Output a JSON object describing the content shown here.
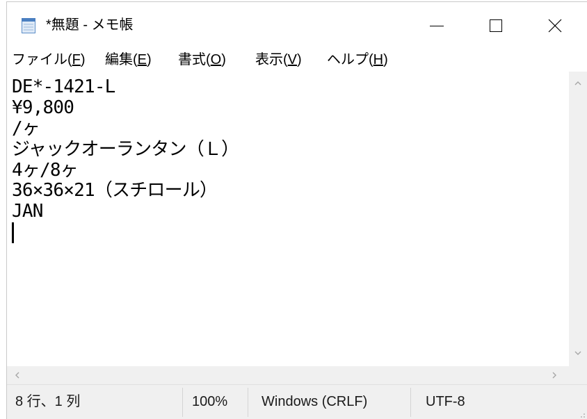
{
  "window": {
    "title": "*無題 - メモ帳",
    "app_icon": "notepad-icon",
    "controls": {
      "minimize_icon": "minimize-icon",
      "maximize_icon": "maximize-icon",
      "close_icon": "close-icon"
    }
  },
  "menu": {
    "items": [
      {
        "before": "ファイル(",
        "accel": "F",
        "after": ")"
      },
      {
        "before": "編集(",
        "accel": "E",
        "after": ")"
      },
      {
        "before": "書式(",
        "accel": "O",
        "after": ")"
      },
      {
        "before": "表示(",
        "accel": "V",
        "after": ")"
      },
      {
        "before": "ヘルプ(",
        "accel": "H",
        "after": ")"
      }
    ]
  },
  "editor": {
    "lines": [
      "DE*-1421-L",
      "¥9,800",
      "/ヶ",
      "ジャックオーランタン（Ｌ）",
      "4ヶ/8ヶ",
      "36×36×21（スチロール）",
      "JAN"
    ]
  },
  "scrollbars": {
    "vertical": {
      "up_icon": "chevron-up-icon",
      "down_icon": "chevron-down-icon"
    },
    "horizontal": {
      "left_icon": "chevron-left-icon",
      "right_icon": "chevron-right-icon"
    }
  },
  "status_bar": {
    "position": "8 行、1 列",
    "zoom": "100%",
    "line_ending": "Windows (CRLF)",
    "encoding": "UTF-8",
    "grip_icon": "resize-grip-icon"
  }
}
